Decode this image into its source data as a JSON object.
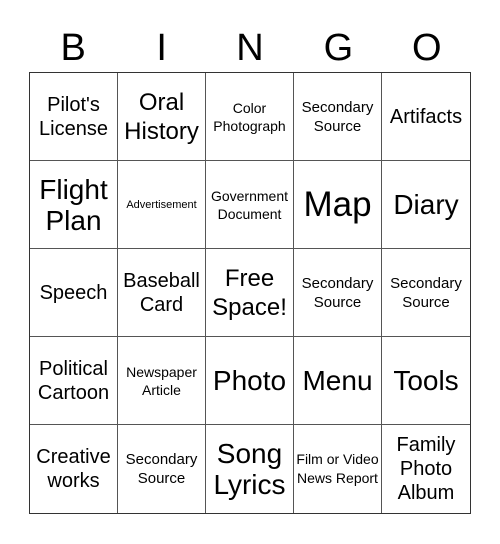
{
  "header": {
    "letters": [
      "B",
      "I",
      "N",
      "G",
      "O"
    ]
  },
  "board": {
    "rows": [
      [
        {
          "text": "Pilot's License",
          "size": "s-m"
        },
        {
          "text": "Oral History",
          "size": "s-ml"
        },
        {
          "text": "Color Photograph",
          "size": "s-xs"
        },
        {
          "text": "Secondary Source",
          "size": "s-s"
        },
        {
          "text": "Artifacts",
          "size": "s-m"
        }
      ],
      [
        {
          "text": "Flight Plan",
          "size": "s-lg"
        },
        {
          "text": "Advertisement",
          "size": "s-xxs"
        },
        {
          "text": "Government Document",
          "size": "s-xs"
        },
        {
          "text": "Map",
          "size": "s-xl"
        },
        {
          "text": "Diary",
          "size": "s-lg"
        }
      ],
      [
        {
          "text": "Speech",
          "size": "s-m"
        },
        {
          "text": "Baseball Card",
          "size": "s-m"
        },
        {
          "text": "Free Space!",
          "size": "s-ml"
        },
        {
          "text": "Secondary Source",
          "size": "s-s"
        },
        {
          "text": "Secondary Source",
          "size": "s-s"
        }
      ],
      [
        {
          "text": "Political Cartoon",
          "size": "s-m"
        },
        {
          "text": "Newspaper Article",
          "size": "s-xs"
        },
        {
          "text": "Photo",
          "size": "s-lg"
        },
        {
          "text": "Menu",
          "size": "s-lg"
        },
        {
          "text": "Tools",
          "size": "s-lg"
        }
      ],
      [
        {
          "text": "Creative works",
          "size": "s-m"
        },
        {
          "text": "Secondary Source",
          "size": "s-s"
        },
        {
          "text": "Song Lyrics",
          "size": "s-lg"
        },
        {
          "text": "Film or Video News Report",
          "size": "s-film"
        },
        {
          "text": "Family Photo Album",
          "size": "s-m"
        }
      ]
    ]
  }
}
